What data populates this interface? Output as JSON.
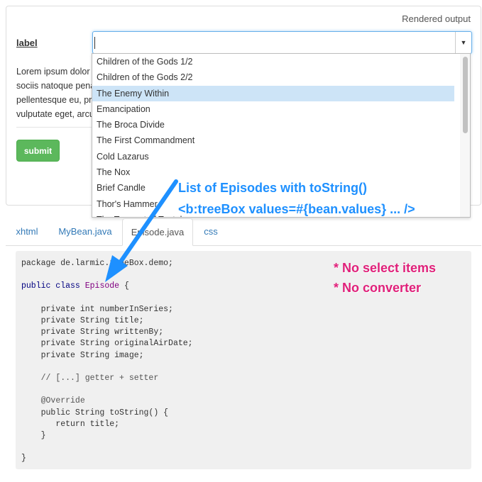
{
  "form": {
    "rendered_output": "Rendered output",
    "label": "label",
    "lorem_lines": [
      "Lorem ipsum dolor",
      "sociis natoque pena",
      "pellentesque eu, pr",
      "vulputate eget, arcu"
    ],
    "submit": "submit"
  },
  "dropdown": {
    "items": [
      "Children of the Gods 1/2",
      "Children of the Gods 2/2",
      "The Enemy Within",
      "Emancipation",
      "The Broca Divide",
      "The First Commandment",
      "Cold Lazarus",
      "The Nox",
      "Brief Candle",
      "Thor's Hammer",
      "The Torment of Tantalus"
    ],
    "selected_index": 2
  },
  "tabs": [
    "xhtml",
    "MyBean.java",
    "Episode.java",
    "css"
  ],
  "active_tab": "Episode.java",
  "code": {
    "line1": "package de.larmic.treeBox.demo;",
    "class_kw": "public class",
    "class_name": "Episode",
    "class_open": " {",
    "fields": [
      "private int numberInSeries;",
      "private String title;",
      "private String writtenBy;",
      "private String originalAirDate;",
      "private String image;"
    ],
    "comment": "// [...] getter + setter",
    "annotation": "@Override",
    "method_sig": "public String toString() {",
    "return_line": "return title;",
    "method_close": "}",
    "class_close": "}"
  },
  "annotations": {
    "blue_line1": "List of Episodes with toString()",
    "blue_line2": "<b:treeBox values=#{bean.values} ... />",
    "pink_line1": "* No select items",
    "pink_line2": "* No converter"
  },
  "colors": {
    "annotation_blue": "#1e90ff",
    "annotation_pink": "#e0207a",
    "submit_green": "#5cb85c",
    "selection": "#cde4f7"
  }
}
